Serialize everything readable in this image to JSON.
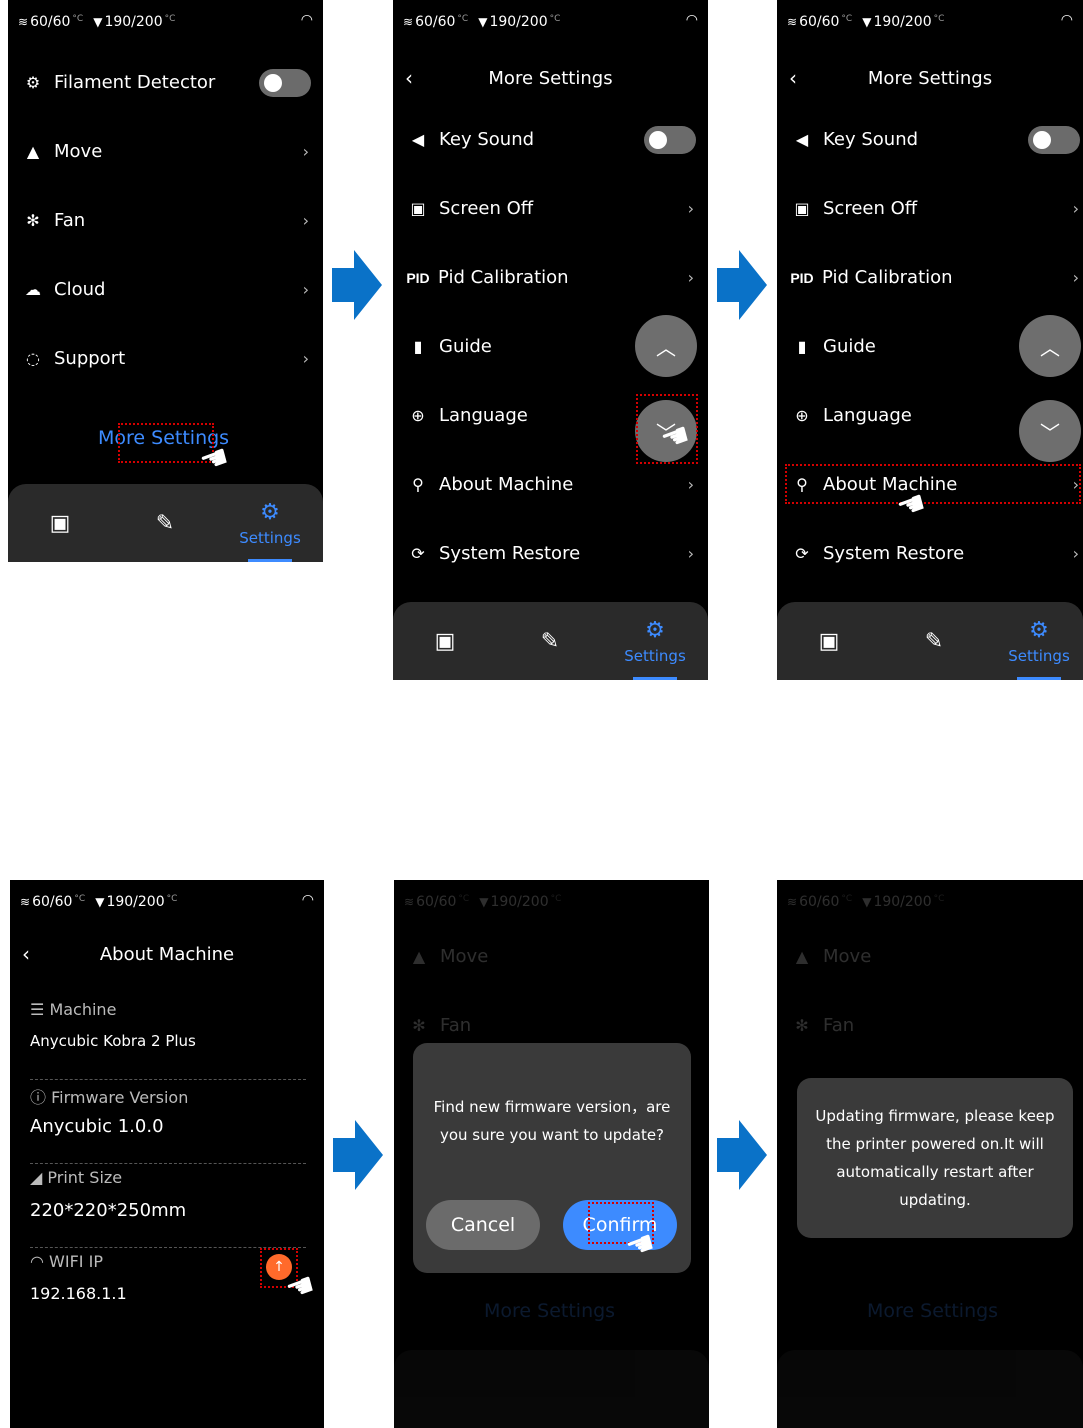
{
  "status": {
    "bed_temp": "60/60",
    "nozzle_temp": "190/200",
    "unit": "°C"
  },
  "screen1": {
    "items": [
      {
        "label": "Filament Detector",
        "icon": "filament-detector-icon"
      },
      {
        "label": "Move",
        "icon": "move-icon"
      },
      {
        "label": "Fan",
        "icon": "fan-icon"
      },
      {
        "label": "Cloud",
        "icon": "cloud-icon"
      },
      {
        "label": "Support",
        "icon": "support-icon"
      }
    ],
    "more_settings": "More Settings"
  },
  "more_settings": {
    "title": "More Settings",
    "items": [
      {
        "label": "Key Sound",
        "icon": "speaker-icon"
      },
      {
        "label": "Screen Off",
        "icon": "screen-off-icon"
      },
      {
        "label": "Pid Calibration",
        "icon_text": "PID"
      },
      {
        "label": "Guide",
        "icon": "book-icon"
      },
      {
        "label": "Language",
        "icon": "globe-icon"
      },
      {
        "label": "About Machine",
        "icon": "about-machine-icon"
      },
      {
        "label": "System Restore",
        "icon": "restore-icon"
      }
    ]
  },
  "bottom_nav": {
    "settings_label": "Settings"
  },
  "about": {
    "title": "About Machine",
    "machine_label": "Machine",
    "machine_value": "Anycubic Kobra 2 Plus",
    "firmware_label": "Firmware Version",
    "firmware_value": "Anycubic 1.0.0",
    "print_size_label": "Print Size",
    "print_size_value": "220*220*250mm",
    "wifi_label": "WIFI IP",
    "wifi_value": "192.168.1.1"
  },
  "dialog_update": {
    "message_line1": "Find new firmware version，are",
    "message_line2": "you sure you want to update?",
    "cancel": "Cancel",
    "confirm": "Confirm"
  },
  "dialog_updating": {
    "line1": "Updating firmware, please keep",
    "line2": "the printer powered on.It will",
    "line3": "automatically restart after",
    "line4": "updating."
  },
  "colors": {
    "accent": "#3d8bff",
    "highlight": "#d40000",
    "update_badge": "#ff6a2b",
    "arrow": "#0a72c8"
  }
}
